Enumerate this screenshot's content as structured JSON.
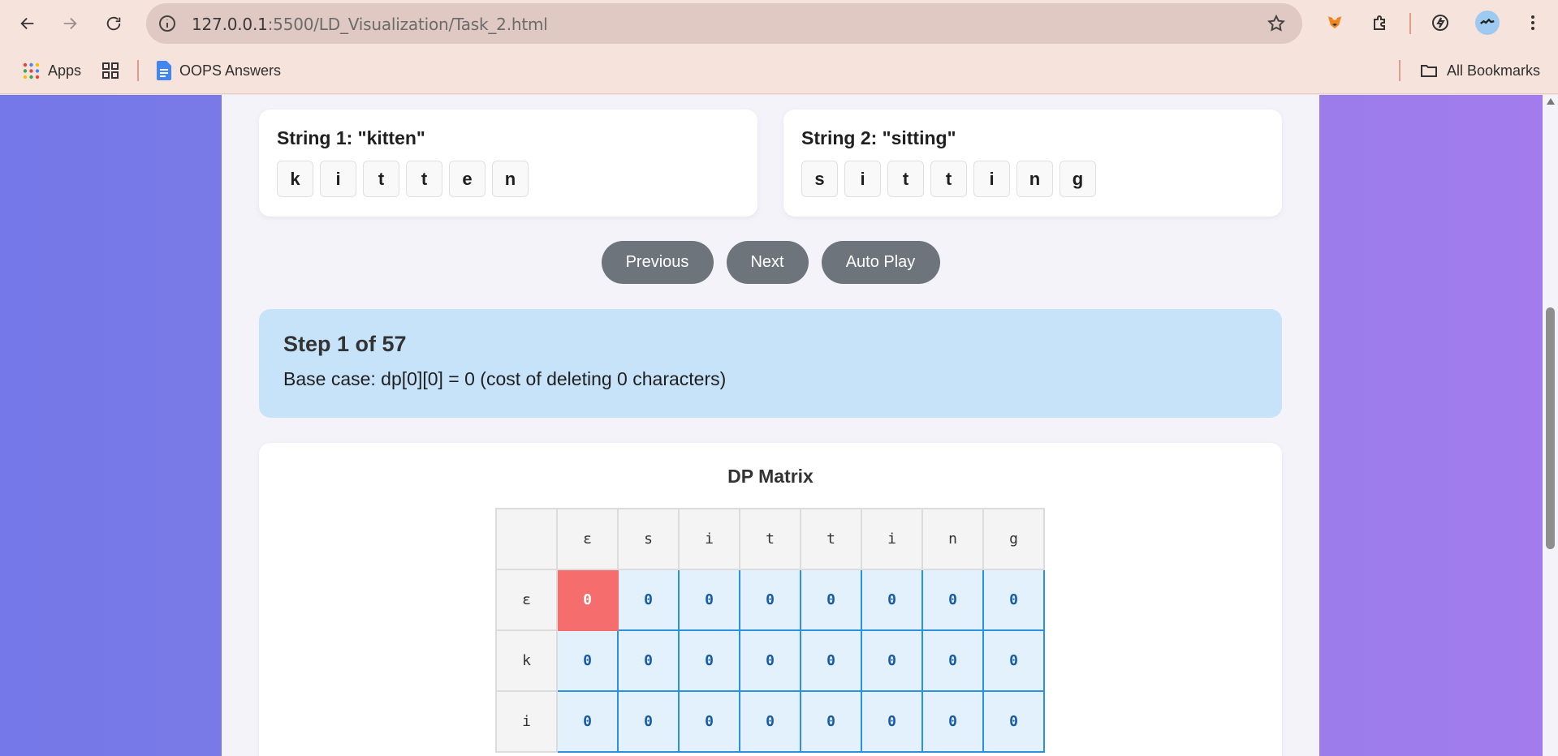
{
  "browser": {
    "url_host": "127.0.0.1",
    "url_path": ":5500/LD_Visualization/Task_2.html",
    "bookmarks": {
      "apps": "Apps",
      "oops": "OOPS Answers",
      "all": "All Bookmarks"
    }
  },
  "strings": {
    "s1": {
      "title": "String 1: \"kitten\"",
      "chars": [
        "k",
        "i",
        "t",
        "t",
        "e",
        "n"
      ]
    },
    "s2": {
      "title": "String 2: \"sitting\"",
      "chars": [
        "s",
        "i",
        "t",
        "t",
        "i",
        "n",
        "g"
      ]
    }
  },
  "controls": {
    "previous": "Previous",
    "next": "Next",
    "autoplay": "Auto Play"
  },
  "step": {
    "title": "Step 1 of 57",
    "description": "Base case: dp[0][0] = 0 (cost of deleting 0 characters)"
  },
  "matrix": {
    "title": "DP Matrix",
    "col_headers": [
      "ε",
      "s",
      "i",
      "t",
      "t",
      "i",
      "n",
      "g"
    ],
    "rows": [
      {
        "label": "ε",
        "values": [
          "0",
          "0",
          "0",
          "0",
          "0",
          "0",
          "0",
          "0"
        ]
      },
      {
        "label": "k",
        "values": [
          "0",
          "0",
          "0",
          "0",
          "0",
          "0",
          "0",
          "0"
        ]
      },
      {
        "label": "i",
        "values": [
          "0",
          "0",
          "0",
          "0",
          "0",
          "0",
          "0",
          "0"
        ]
      }
    ],
    "current_cell": [
      0,
      0
    ]
  }
}
